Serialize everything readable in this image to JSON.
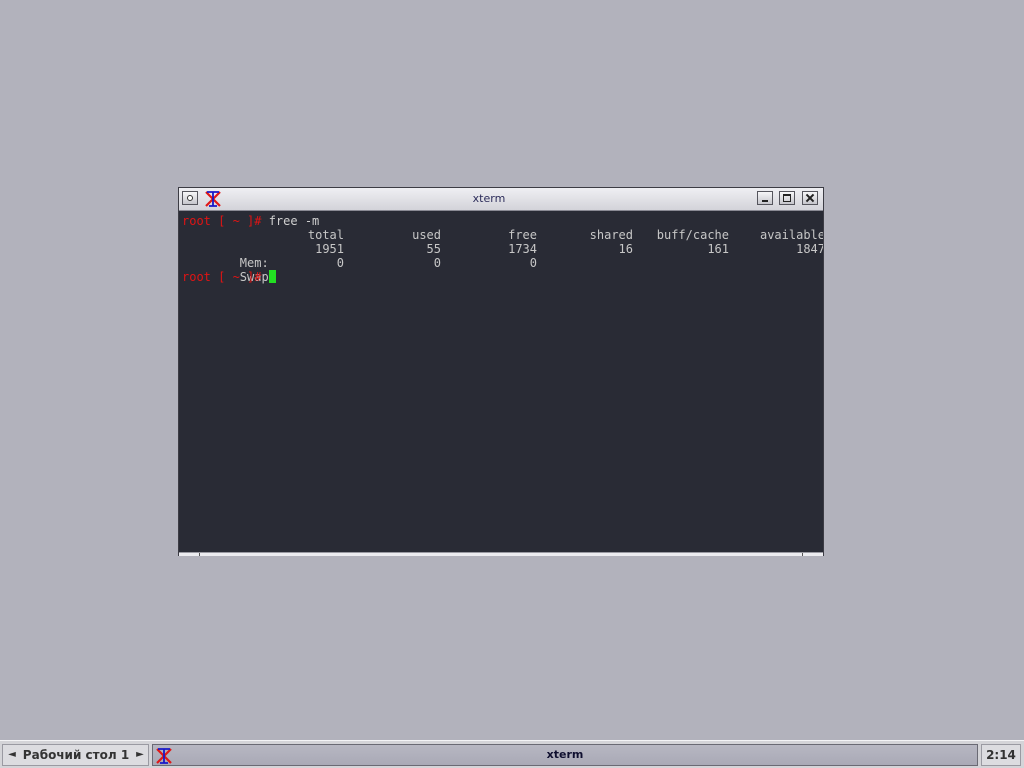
{
  "window": {
    "title": "xterm",
    "app_icon": "xterm-x-icon"
  },
  "terminal": {
    "prompt": "root [ ~ ]# ",
    "command": "free -m",
    "headers": [
      "total",
      "used",
      "free",
      "shared",
      "buff/cache",
      "available"
    ],
    "rows": [
      {
        "label": "Mem:",
        "values": [
          "1951",
          "55",
          "1734",
          "16",
          "161",
          "1847"
        ]
      },
      {
        "label": "Swap:",
        "values": [
          "0",
          "0",
          "0",
          "",
          "",
          ""
        ]
      }
    ],
    "prompt2": "root [ ~ ]# ",
    "colors": {
      "background": "#292b35",
      "prompt": "#e01414",
      "text": "#c7c7c7",
      "cursor": "#22e022"
    }
  },
  "taskbar": {
    "desktop_label": "Рабочий стол 1",
    "prev_arrow": "◄",
    "next_arrow": "►",
    "task_label": "xterm",
    "clock": "2:14"
  }
}
